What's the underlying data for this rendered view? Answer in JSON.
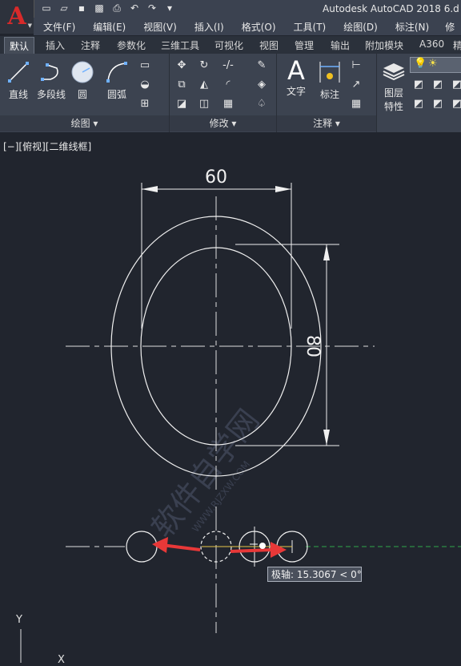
{
  "app": {
    "title": "Autodesk AutoCAD 2018    6.d",
    "logo": "A"
  },
  "quick_access": {
    "icons": [
      "new-icon",
      "open-icon",
      "save-icon",
      "saveas-icon",
      "print-icon",
      "undo-icon",
      "redo-icon",
      "customize-icon"
    ],
    "glyphs": [
      "▭",
      "▱",
      "▪",
      "▩",
      "⎙",
      "↶",
      "↷",
      "▾"
    ]
  },
  "menubar": {
    "items": [
      "文件(F)",
      "编辑(E)",
      "视图(V)",
      "插入(I)",
      "格式(O)",
      "工具(T)",
      "绘图(D)",
      "标注(N)",
      "修"
    ]
  },
  "ribbon_tabs": [
    "默认",
    "插入",
    "注释",
    "参数化",
    "三维工具",
    "可视化",
    "视图",
    "管理",
    "输出",
    "附加模块",
    "A360",
    "精"
  ],
  "ribbon": {
    "draw_panel": {
      "tools": [
        "直线",
        "多段线",
        "圆",
        "圆弧"
      ],
      "footer": "绘图 ▾"
    },
    "modify_panel": {
      "footer": "修改 ▾"
    },
    "annotate_panel": {
      "tools": [
        "文字",
        "标注"
      ],
      "footer": "注释 ▾"
    },
    "layers_panel": {
      "tool": "图层\n特性",
      "tool_line1": "图层",
      "tool_line2": "特性"
    }
  },
  "viewport": {
    "label": "[−][俯视][二维线框]",
    "dim_horizontal": "60",
    "dim_vertical": "80",
    "watermark": "软件自学网",
    "watermark_url": "WWW.RJZXW.COM"
  },
  "tooltip": {
    "text": "极轴: 15.3067 < 0°"
  },
  "ucs": {
    "y": "Y",
    "x": "X"
  },
  "colors": {
    "background": "#21252e",
    "ribbon": "#3c4350",
    "geometry": "#ffffff",
    "arrow": "#e83838",
    "polar_track": "#2ea84a",
    "logo": "#d82a2a"
  }
}
